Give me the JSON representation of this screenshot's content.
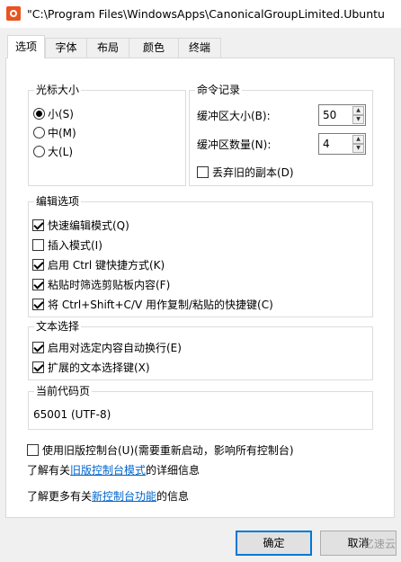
{
  "window": {
    "title": "\"C:\\Program Files\\WindowsApps\\CanonicalGroupLimited.Ubuntu"
  },
  "tabs": [
    {
      "label": "选项",
      "active": true
    },
    {
      "label": "字体",
      "active": false
    },
    {
      "label": "布局",
      "active": false
    },
    {
      "label": "颜色",
      "active": false
    },
    {
      "label": "终端",
      "active": false
    }
  ],
  "cursor_size": {
    "title": "光标大小",
    "options": [
      {
        "label": "小(S)",
        "selected": true
      },
      {
        "label": "中(M)",
        "selected": false
      },
      {
        "label": "大(L)",
        "selected": false
      }
    ]
  },
  "command_history": {
    "title": "命令记录",
    "buffer_size_label": "缓冲区大小(B):",
    "buffer_size_value": "50",
    "buffer_count_label": "缓冲区数量(N):",
    "buffer_count_value": "4",
    "discard_old_label": "丢弃旧的副本(D)",
    "discard_old_checked": false
  },
  "edit_options": {
    "title": "编辑选项",
    "items": [
      {
        "label": "快速编辑模式(Q)",
        "checked": true
      },
      {
        "label": "插入模式(I)",
        "checked": false
      },
      {
        "label": "启用 Ctrl 键快捷方式(K)",
        "checked": true
      },
      {
        "label": "粘贴时筛选剪贴板内容(F)",
        "checked": true
      },
      {
        "label": "将 Ctrl+Shift+C/V 用作复制/粘贴的快捷键(C)",
        "checked": true
      }
    ]
  },
  "text_selection": {
    "title": "文本选择",
    "items": [
      {
        "label": "启用对选定内容自动换行(E)",
        "checked": true
      },
      {
        "label": "扩展的文本选择键(X)",
        "checked": true
      }
    ]
  },
  "code_page": {
    "title": "当前代码页",
    "value": "65001 (UTF-8)"
  },
  "legacy": {
    "label": "使用旧版控制台(U)(需要重新启动，影响所有控制台)",
    "checked": false,
    "info_prefix": "了解有关",
    "info_link": "旧版控制台模式",
    "info_suffix": "的详细信息",
    "more_prefix": "了解更多有关",
    "more_link": "新控制台功能",
    "more_suffix": "的信息"
  },
  "buttons": {
    "ok": "确定",
    "cancel": "取消"
  },
  "watermark": "亿速云",
  "colors": {
    "accent": "#0078d7",
    "link": "#0066cc",
    "app_icon": "#e95420"
  }
}
